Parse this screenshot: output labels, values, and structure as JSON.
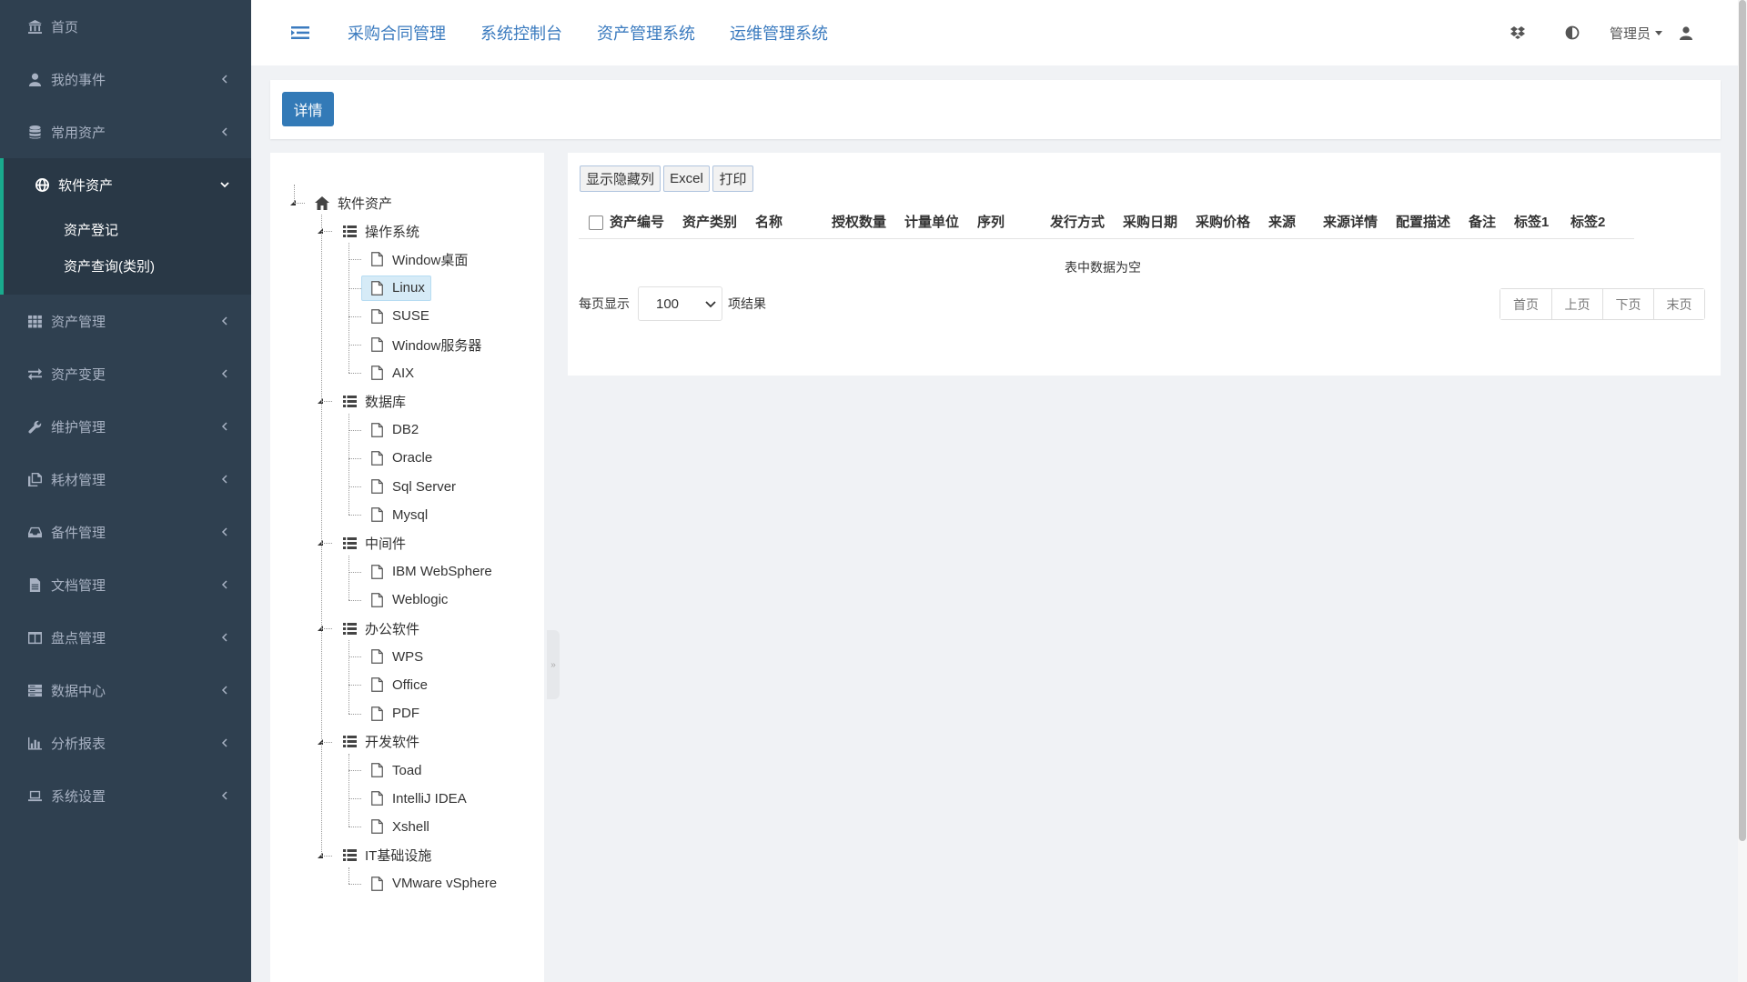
{
  "sidebar": {
    "items": [
      {
        "label": "首页",
        "icon": "bank-icon"
      },
      {
        "label": "我的事件",
        "icon": "user-icon"
      },
      {
        "label": "常用资产",
        "icon": "database-icon"
      },
      {
        "label": "软件资产",
        "icon": "globe-icon",
        "expanded": true,
        "children": [
          "资产登记",
          "资产查询(类别)"
        ]
      },
      {
        "label": "资产管理",
        "icon": "grid-icon"
      },
      {
        "label": "资产变更",
        "icon": "exchange-icon"
      },
      {
        "label": "维护管理",
        "icon": "wrench-icon"
      },
      {
        "label": "耗材管理",
        "icon": "copy-icon"
      },
      {
        "label": "备件管理",
        "icon": "inbox-icon"
      },
      {
        "label": "文档管理",
        "icon": "file-icon"
      },
      {
        "label": "盘点管理",
        "icon": "columns-icon"
      },
      {
        "label": "数据中心",
        "icon": "server-icon"
      },
      {
        "label": "分析报表",
        "icon": "bar-chart-icon"
      },
      {
        "label": "系统设置",
        "icon": "laptop-icon"
      }
    ]
  },
  "header": {
    "links": [
      "采购合同管理",
      "系统控制台",
      "资产管理系统",
      "运维管理系统"
    ],
    "user": "管理员"
  },
  "detail": {
    "button": "详情"
  },
  "tree": {
    "root": "软件资产",
    "groups": [
      {
        "label": "操作系统",
        "children": [
          "Window桌面",
          "Linux",
          "SUSE",
          "Window服务器",
          "AIX"
        ]
      },
      {
        "label": "数据库",
        "children": [
          "DB2",
          "Oracle",
          "Sql Server",
          "Mysql"
        ]
      },
      {
        "label": "中间件",
        "children": [
          "IBM WebSphere",
          "Weblogic"
        ]
      },
      {
        "label": "办公软件",
        "children": [
          "WPS",
          "Office",
          "PDF"
        ]
      },
      {
        "label": "开发软件",
        "children": [
          "Toad",
          "IntelliJ IDEA",
          "Xshell"
        ]
      },
      {
        "label": "IT基础设施",
        "children": [
          "VMware vSphere"
        ]
      }
    ],
    "selected": "Linux"
  },
  "table": {
    "toolbar": [
      "显示隐藏列",
      "Excel",
      "打印"
    ],
    "columns": [
      "资产编号",
      "资产类别",
      "名称",
      "授权数量",
      "计量单位",
      "序列",
      "发行方式",
      "采购日期",
      "采购价格",
      "来源",
      "来源详情",
      "配置描述",
      "备注",
      "标签1",
      "标签2"
    ],
    "empty_message": "表中数据为空",
    "page_size_label": "每页显示",
    "page_size": "100",
    "page_size_suffix": "项结果",
    "pager": [
      "首页",
      "上页",
      "下页",
      "末页"
    ]
  }
}
